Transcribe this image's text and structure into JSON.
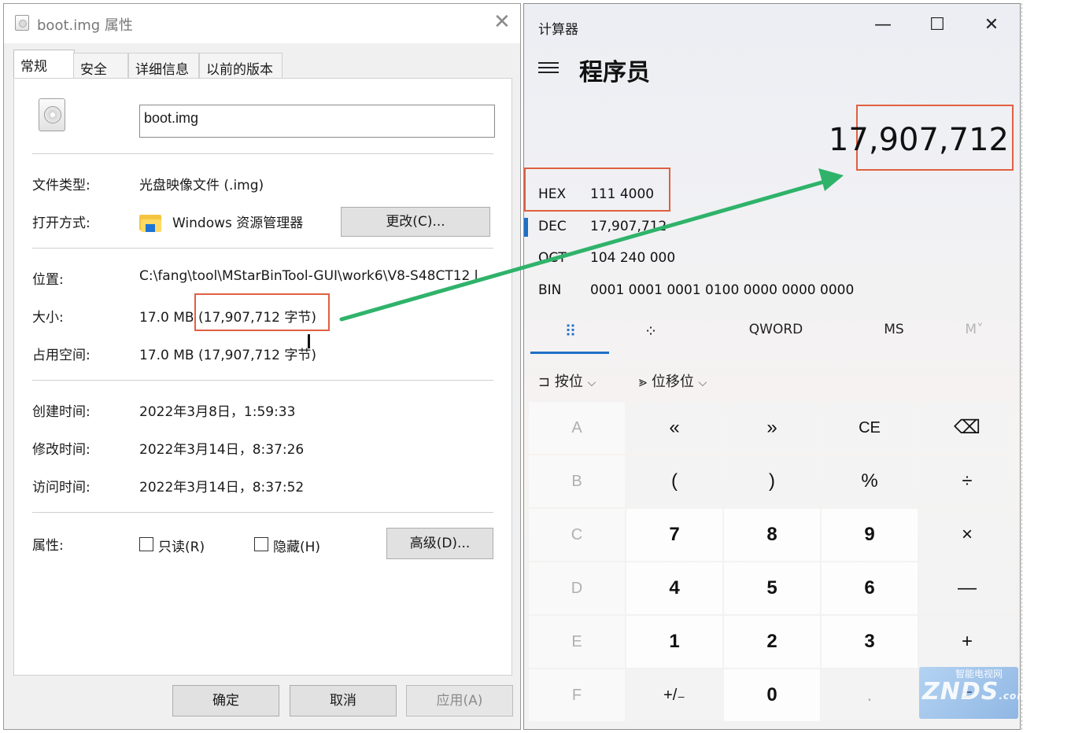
{
  "props": {
    "title": "boot.img 属性",
    "close": "✕",
    "tabs": [
      "常规",
      "安全",
      "详细信息",
      "以前的版本"
    ],
    "filename": "boot.img",
    "rows": {
      "type_label": "文件类型:",
      "type_value": "光盘映像文件 (.img)",
      "open_label": "打开方式:",
      "open_value": "Windows 资源管理器",
      "change_button": "更改(C)...",
      "location_label": "位置:",
      "location_value": "C:\\fang\\tool\\MStarBinTool-GUI\\work6\\V8-S48CT12 l",
      "size_label": "大小:",
      "size_value_prefix": "17.0 MB ",
      "size_value_bytes": "(17,907,712 字节)",
      "disk_label": "占用空间:",
      "disk_value": "17.0 MB (17,907,712 字节)",
      "created_label": "创建时间:",
      "created_value": "2022年3月8日，1:59:33",
      "modified_label": "修改时间:",
      "modified_value": "2022年3月14日，8:37:26",
      "accessed_label": "访问时间:",
      "accessed_value": "2022年3月14日，8:37:52",
      "attr_label": "属性:",
      "readonly_label": "只读(R)",
      "hidden_label": "隐藏(H)",
      "advanced_button": "高级(D)..."
    },
    "footer": {
      "ok": "确定",
      "cancel": "取消",
      "apply": "应用(A)"
    }
  },
  "calc": {
    "title": "计算器",
    "minimize": "—",
    "maximize": "☐",
    "close": "✕",
    "mode": "程序员",
    "display": "17,907,712",
    "radix": [
      {
        "name": "HEX",
        "value": "111 4000"
      },
      {
        "name": "DEC",
        "value": "17,907,712"
      },
      {
        "name": "OCT",
        "value": "104 240 000"
      },
      {
        "name": "BIN",
        "value": "0001 0001 0001 0100 0000 0000 0000"
      }
    ],
    "tabs": {
      "keypad_icon": "⠿",
      "bits_icon": "⁘",
      "word": "QWORD",
      "ms": "MS",
      "m": "M˅"
    },
    "bitwise": {
      "label": "按位",
      "shift": "位移位",
      "chevron": "⌵"
    },
    "keys": [
      [
        "A",
        "«",
        "»",
        "CE",
        "⌫"
      ],
      [
        "B",
        "(",
        ")",
        "%",
        "÷"
      ],
      [
        "C",
        "7",
        "8",
        "9",
        "×"
      ],
      [
        "D",
        "4",
        "5",
        "6",
        "—"
      ],
      [
        "E",
        "1",
        "2",
        "3",
        "+"
      ],
      [
        "F",
        "+/₋",
        "0",
        ".",
        "="
      ]
    ]
  },
  "watermark": {
    "brand": "ZNDS",
    "sub": "智能电视网",
    "suffix": ".com"
  },
  "colors": {
    "highlight": "#e06040",
    "arrow": "#2fb36a",
    "accent": "#1f6fc5"
  }
}
